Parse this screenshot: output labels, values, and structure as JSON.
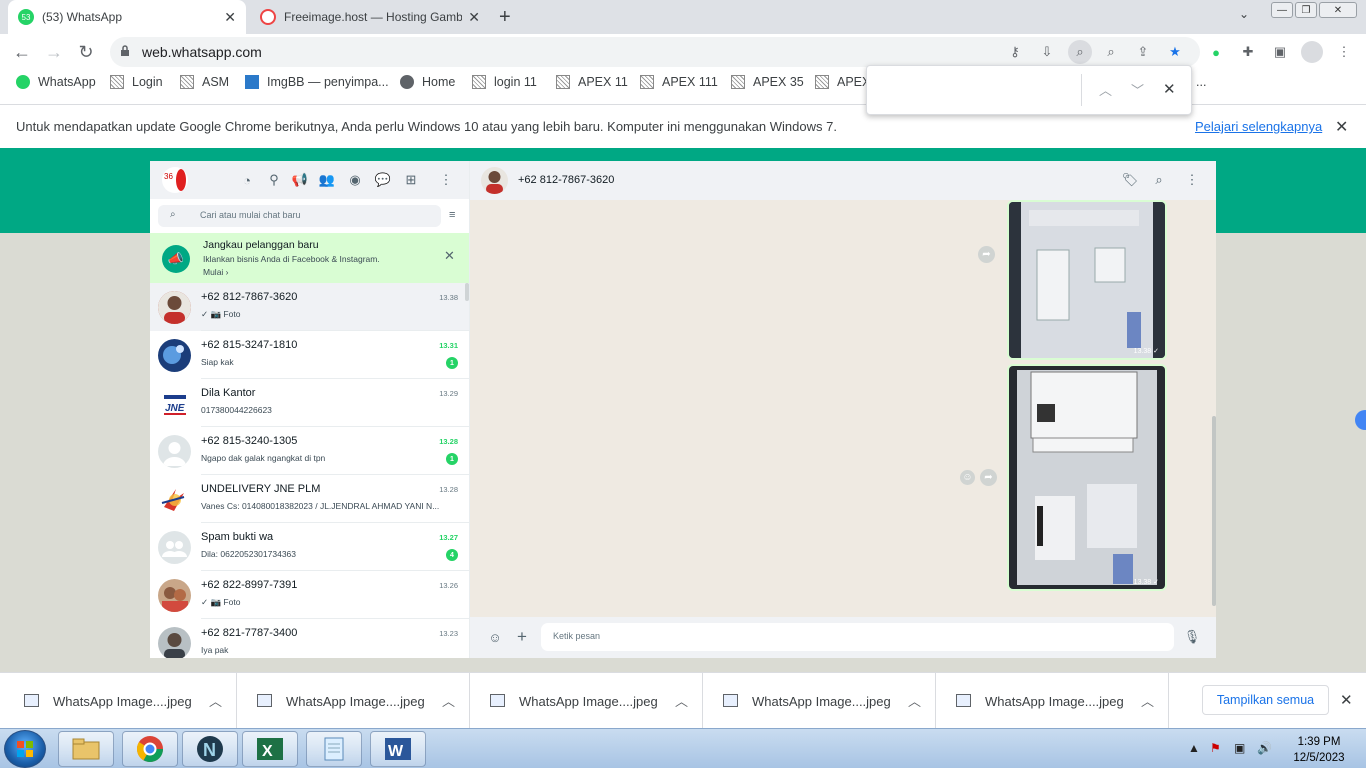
{
  "browser": {
    "tabs": [
      {
        "title": "(53) WhatsApp",
        "favicon_badge": "53"
      },
      {
        "title": "Freeimage.host — Hosting Gamb"
      }
    ],
    "new_tab_symbol": "+",
    "address": "web.whatsapp.com",
    "bookmarks": [
      "WhatsApp",
      "Login",
      "ASM",
      "ImgBB — penyimpa...",
      "Home",
      "login 11",
      "APEX 11",
      "APEX 111",
      "APEX 35",
      "APEX"
    ],
    "bookmark_overflow": "...",
    "infobar_text": "Untuk mendapatkan update Google Chrome berikutnya, Anda perlu Windows 10 atau yang lebih baru. Komputer ini menggunakan Windows 7.",
    "infobar_link": "Pelajari selengkapnya"
  },
  "whatsapp": {
    "search_placeholder": "Cari atau mulai chat baru",
    "promo": {
      "title": "Jangkau pelanggan baru",
      "text": "Iklankan bisnis Anda di Facebook & Instagram.",
      "link": "Mulai ›"
    },
    "chats": [
      {
        "name": "+62 812-7867-3620",
        "msg": "✓ 📷 Foto",
        "time": "13.38",
        "unread": "",
        "avatar": "#b33a2c",
        "selected": true
      },
      {
        "name": "+62 815-3247-1810",
        "msg": "Siap kak",
        "time": "13.31",
        "unread": "1",
        "avatar": "#2a5fa8"
      },
      {
        "name": "Dila Kantor",
        "msg": "017380044226623",
        "time": "13.29",
        "unread": "",
        "avatar": "#1c3d8c"
      },
      {
        "name": "+62 815-3240-1305",
        "msg": "Ngapo dak galak ngangkat di tpn",
        "time": "13.28",
        "unread": "1",
        "avatar": "#cfd4d6"
      },
      {
        "name": "UNDELIVERY JNE PLM",
        "msg": "Vanes Cs: 014080018382023 / JL.JENDRAL AHMAD YANI N...",
        "time": "13.28",
        "unread": "",
        "avatar": "#d8362a"
      },
      {
        "name": "Spam bukti wa",
        "msg": "Dila: 0622052301734363",
        "time": "13.27",
        "unread": "4",
        "avatar": "#cfd4d6"
      },
      {
        "name": "+62 822-8997-7391",
        "msg": "✓ 📷 Foto",
        "time": "13.26",
        "unread": "",
        "avatar": "#a66a4e"
      },
      {
        "name": "+62 821-7787-3400",
        "msg": "Iya pak",
        "time": "13.23",
        "unread": "",
        "avatar": "#7f8a90"
      }
    ],
    "conversation": {
      "name": "+62 812-7867-3620",
      "images": [
        {
          "time": "13.38 ✓"
        },
        {
          "time": "13.38 ✓"
        }
      ],
      "input_placeholder": "Ketik pesan"
    }
  },
  "downloads": {
    "items": [
      "WhatsApp Image....jpeg",
      "WhatsApp Image....jpeg",
      "WhatsApp Image....jpeg",
      "WhatsApp Image....jpeg",
      "WhatsApp Image....jpeg"
    ],
    "show_all": "Tampilkan semua"
  },
  "taskbar": {
    "time": "1:39 PM",
    "date": "12/5/2023",
    "apps": [
      "explorer",
      "chrome",
      "n-app",
      "excel",
      "notepad",
      "word"
    ]
  }
}
